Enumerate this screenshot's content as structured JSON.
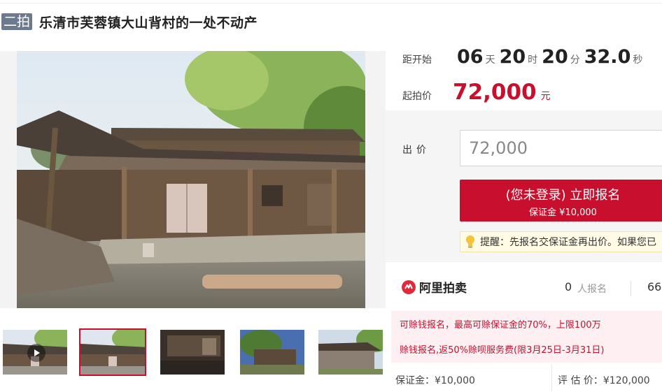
{
  "header": {
    "round_badge": "二拍",
    "title": "乐清市芙蓉镇大山背村的一处不动产"
  },
  "countdown": {
    "label": "距开始",
    "days": "06",
    "days_unit": "天",
    "hours": "20",
    "hours_unit": "时",
    "minutes": "20",
    "minutes_unit": "分",
    "seconds": "32.0",
    "seconds_unit": "秒"
  },
  "starting_price": {
    "label": "起拍价",
    "value": "72,000",
    "unit": "元"
  },
  "bid": {
    "label": "出价",
    "input_value": "72,000",
    "signup_button": "(您未登录) 立即报名",
    "signup_sub": "保证金 ¥10,000",
    "tip": "提醒：先报名交保证金再出价。如果您已"
  },
  "platform": {
    "logo_text": "阿里拍卖",
    "signup_count": "0",
    "signup_count_label": "人报名",
    "views_count": "66"
  },
  "promo": {
    "line1": "可赊钱报名，最高可赊保证金的70%，上限100万",
    "line2": "赊钱报名,返50%赊呗服务费(限3月25日-3月31日)"
  },
  "footer_info": {
    "deposit": "保证金：¥10,000",
    "evaluation": "评 估 价：¥120,000"
  },
  "icons": {
    "zoom": "magnifier-icon",
    "play": "play-icon",
    "tip": "lightbulb-icon",
    "logo": "ali-auction-logo-icon"
  },
  "colors": {
    "accent": "#c8102e",
    "badge": "#6b7a8f",
    "promo_bg": "#fdeff2"
  }
}
